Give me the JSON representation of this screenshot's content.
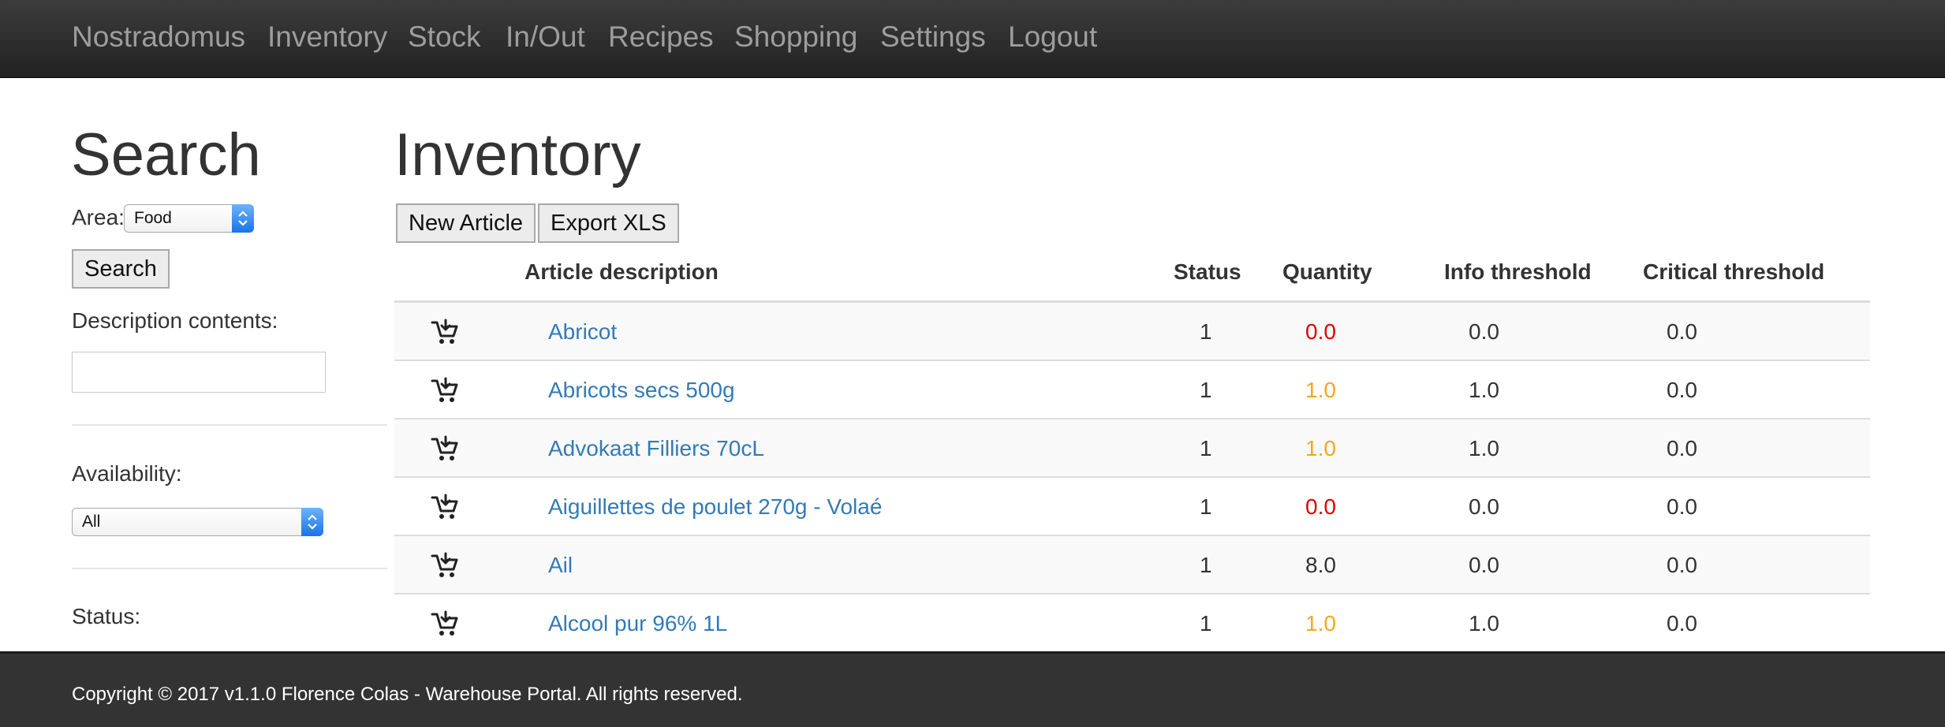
{
  "nav": {
    "brand": "Nostradomus",
    "items": [
      "Inventory",
      "Stock",
      "In/Out",
      "Recipes",
      "Shopping",
      "Settings",
      "Logout"
    ]
  },
  "sidebar": {
    "title": "Search",
    "area_label": "Area:",
    "area_value": "Food",
    "search_button": "Search",
    "description_label": "Description contents:",
    "description_value": "",
    "availability_label": "Availability:",
    "availability_value": "All",
    "status_label": "Status:"
  },
  "main": {
    "title": "Inventory",
    "new_article_button": "New Article",
    "export_button": "Export XLS",
    "columns": {
      "description": "Article description",
      "status": "Status",
      "quantity": "Quantity",
      "info": "Info threshold",
      "critical": "Critical threshold"
    },
    "rows": [
      {
        "description": "Abricot",
        "status": "1",
        "quantity": "0.0",
        "quantity_color": "#e00000",
        "info": "0.0",
        "critical": "0.0"
      },
      {
        "description": "Abricots secs 500g",
        "status": "1",
        "quantity": "1.0",
        "quantity_color": "#f5a623",
        "info": "1.0",
        "critical": "0.0"
      },
      {
        "description": "Advokaat Filliers 70cL",
        "status": "1",
        "quantity": "1.0",
        "quantity_color": "#f5a623",
        "info": "1.0",
        "critical": "0.0"
      },
      {
        "description": "Aiguillettes de poulet 270g - Volaé",
        "status": "1",
        "quantity": "0.0",
        "quantity_color": "#e00000",
        "info": "0.0",
        "critical": "0.0"
      },
      {
        "description": "Ail",
        "status": "1",
        "quantity": "8.0",
        "quantity_color": "#333333",
        "info": "0.0",
        "critical": "0.0"
      },
      {
        "description": "Alcool pur 96% 1L",
        "status": "1",
        "quantity": "1.0",
        "quantity_color": "#f5a623",
        "info": "1.0",
        "critical": "0.0"
      }
    ],
    "row_icon": "add-to-cart-icon",
    "link_color": "#337ab7"
  },
  "footer": {
    "text": "Copyright © 2017 v1.1.0 Florence Colas - Warehouse Portal. All rights reserved."
  }
}
